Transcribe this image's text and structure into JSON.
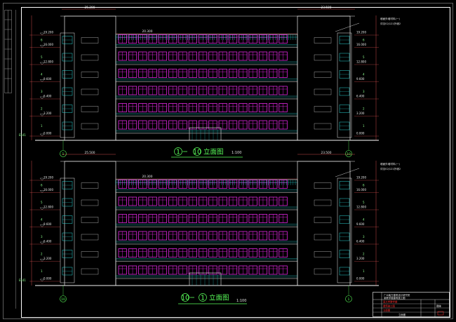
{
  "elevation_top": {
    "title_axis_start": "1",
    "title_axis_end": "10",
    "title_suffix": "立面图",
    "scale": "1:100",
    "top_dims": [
      "25.200",
      "20.300",
      "23.500"
    ],
    "level_left": "EL41",
    "elevation_marks": [
      "19.200",
      "16.000",
      "12.800",
      "9.600",
      "6.400",
      "3.200",
      "0.000"
    ],
    "floor_numbers": [
      "6",
      "5",
      "4",
      "3",
      "2",
      "1"
    ],
    "axis_left": "1",
    "axis_right": "10",
    "note_lines": [
      "墙面外墙材料(一)",
      "详见02J121外墙2"
    ]
  },
  "elevation_bottom": {
    "title_axis_start": "10",
    "title_axis_end": "1",
    "title_suffix": "立面图",
    "scale": "1:100",
    "top_dims": [
      "25.500",
      "20.300",
      "23.500"
    ],
    "level_left": "EL41",
    "elevation_marks": [
      "19.200",
      "16.000",
      "12.800",
      "9.600",
      "6.400",
      "3.200",
      "0.000"
    ],
    "floor_numbers": [
      "6",
      "5",
      "4",
      "3",
      "2",
      "1"
    ],
    "axis_left": "10",
    "axis_right": "1",
    "note_lines": [
      "墙面外墙材料(一)",
      "详见02J121外墙2"
    ]
  },
  "title_block": {
    "company": "广州南方建筑设计研究院",
    "company_sub": "某教学楼建筑施工图",
    "project_lines": [
      "某大学教学楼",
      "建筑施工图",
      "立面图"
    ],
    "drawing_name": "立面图",
    "sheet_no": "建施"
  },
  "colors": {
    "background": "#000000",
    "frame": "#ffffff",
    "windows": "#ff2bff",
    "railings": "#2ad4d4",
    "walls": "#e8e8e8",
    "dimensions": "#ff5a5a",
    "annotations": "#5aff5a"
  }
}
